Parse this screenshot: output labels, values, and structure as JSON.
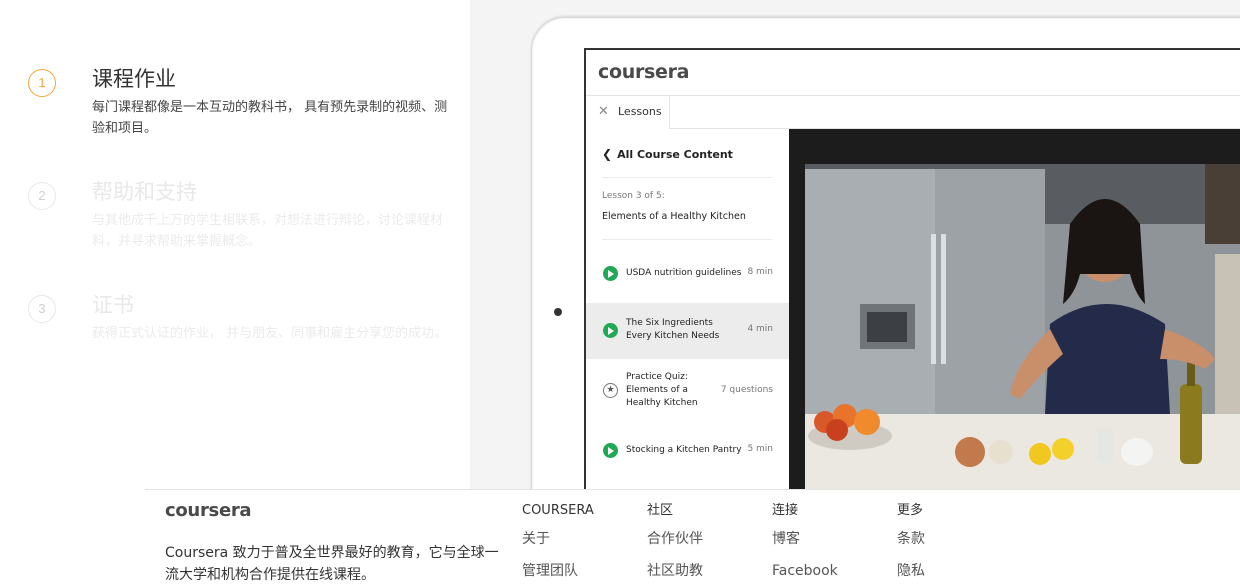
{
  "steps": [
    {
      "number": "1",
      "title": "课程作业",
      "description": "每门课程都像是一本互动的教科书， 具有预先录制的视频、测验和项目。",
      "active": true
    },
    {
      "number": "2",
      "title": "帮助和支持",
      "description": "与其他成千上万的学生相联系，对想法进行辩论，讨论课程材料，并寻求帮助来掌握概念。",
      "active": false
    },
    {
      "number": "3",
      "title": "证书",
      "description": "获得正式认证的作业， 并与朋友、同事和雇主分享您的成功。",
      "active": false
    }
  ],
  "app": {
    "logo": "coursera",
    "tab_label": "Lessons",
    "back_label": "All Course Content",
    "lesson_meta": "Lesson 3 of 5:",
    "lesson_title": "Elements of a Healthy Kitchen",
    "items": [
      {
        "type": "video",
        "title": "USDA nutrition guidelines",
        "duration": "8 min"
      },
      {
        "type": "video",
        "title": "The Six Ingredients Every Kitchen Needs",
        "duration": "4 min",
        "selected": true
      },
      {
        "type": "quiz",
        "title": "Practice Quiz: Elements of a Healthy Kitchen",
        "duration": "7 questions"
      },
      {
        "type": "video",
        "title": "Stocking a Kitchen Pantry",
        "duration": "5 min"
      }
    ]
  },
  "footer": {
    "logo": "coursera",
    "description": "Coursera 致力于普及全世界最好的教育，它与全球一流大学和机构合作提供在线课程。",
    "columns": [
      {
        "heading": "COURSERA",
        "links": [
          "关于",
          "管理团队"
        ]
      },
      {
        "heading": "社区",
        "links": [
          "合作伙伴",
          "社区助教"
        ]
      },
      {
        "heading": "连接",
        "links": [
          "博客",
          "Facebook"
        ]
      },
      {
        "heading": "更多",
        "links": [
          "条款",
          "隐私"
        ]
      }
    ]
  },
  "colors": {
    "accent": "#f2a73b",
    "play": "#1fa855"
  }
}
